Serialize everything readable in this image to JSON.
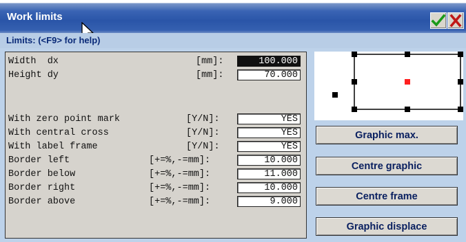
{
  "window": {
    "title": "Work limits",
    "ok_icon": "checkmark-icon",
    "close_icon": "close-icon",
    "ok_color": "#1a9a1a",
    "close_color": "#c01818"
  },
  "header": {
    "hint": "Limits: (<F9> for help)"
  },
  "fields": [
    {
      "label": "Width  dx",
      "unit": "[mm]:",
      "value": "100.000",
      "selected": true
    },
    {
      "label": "Height dy",
      "unit": "[mm]:",
      "value": "70.000"
    },
    {
      "label": "With zero point mark",
      "unit": "[Y/N]:",
      "value": "YES"
    },
    {
      "label": "With central cross",
      "unit": "[Y/N]:",
      "value": "YES"
    },
    {
      "label": "With label frame",
      "unit": "[Y/N]:",
      "value": "YES"
    },
    {
      "label": "Border left",
      "unit": "[+=%,-=mm]:",
      "value": "10.000"
    },
    {
      "label": "Border below",
      "unit": "[+=%,-=mm]:",
      "value": "11.000"
    },
    {
      "label": "Border right",
      "unit": "[+=%,-=mm]:",
      "value": "10.000"
    },
    {
      "label": "Border above",
      "unit": "[+=%,-=mm]:",
      "value": "9.000"
    }
  ],
  "buttons": {
    "graphic_max": "Graphic max.",
    "centre_graphic": "Centre graphic",
    "centre_frame": "Centre frame",
    "graphic_displace": "Graphic displace"
  },
  "colors": {
    "title_bar": "#2a55a8",
    "subheader": "#b8cde6",
    "panel": "#d6d3cd",
    "preview_center_marker": "#ff2020"
  }
}
